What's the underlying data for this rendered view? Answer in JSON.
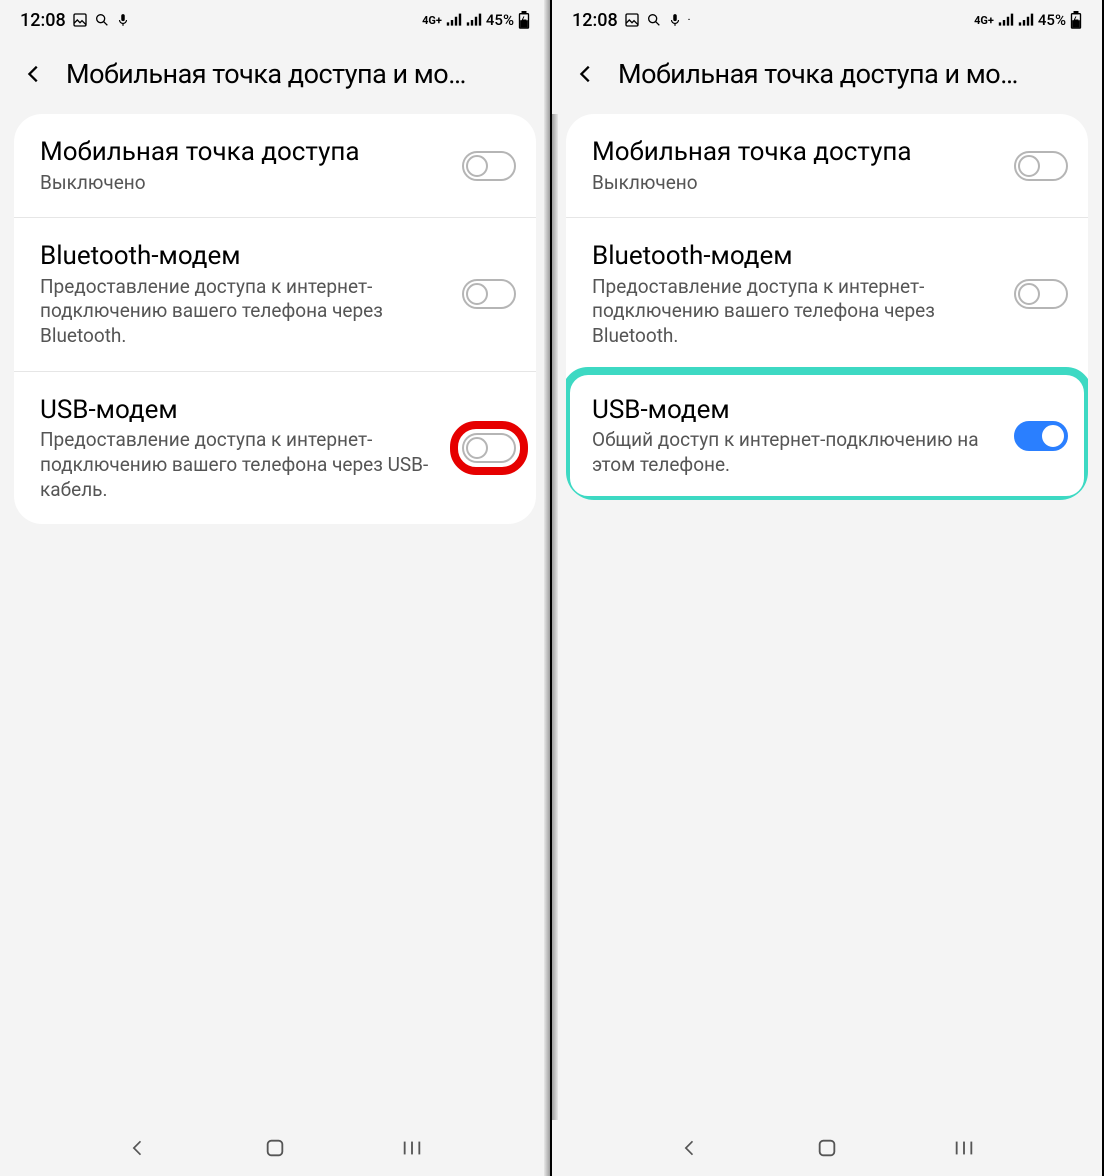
{
  "status": {
    "time": "12:08",
    "network_label": "4G+",
    "battery_percent": "45%"
  },
  "header": {
    "title": "Мобильная точка доступа и мо…"
  },
  "left": {
    "rows": [
      {
        "title": "Мобильная точка доступа",
        "sub": "Выключено",
        "on": false
      },
      {
        "title": "Bluetooth-модем",
        "sub": "Предоставление доступа к интернет-подключению вашего телефона через Bluetooth.",
        "on": false
      },
      {
        "title": "USB-модем",
        "sub": "Предоставление доступа к интернет-подключению вашего телефона через USB-кабель.",
        "on": false
      }
    ]
  },
  "right": {
    "rows": [
      {
        "title": "Мобильная точка доступа",
        "sub": "Выключено",
        "on": false
      },
      {
        "title": "Bluetooth-модем",
        "sub": "Предоставление доступа к интернет-подключению вашего телефона через Bluetooth.",
        "on": false
      },
      {
        "title": "USB-модем",
        "sub": "Общий доступ к интернет-подключению на этом телефоне.",
        "on": true
      }
    ]
  }
}
